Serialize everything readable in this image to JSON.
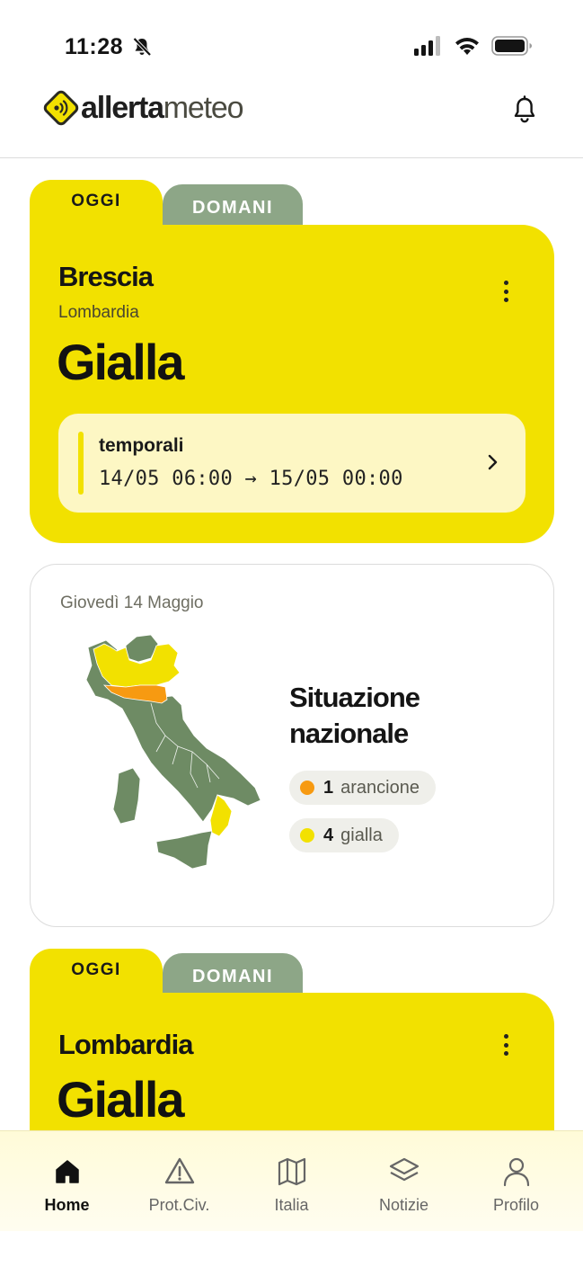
{
  "status": {
    "time": "11:28"
  },
  "header": {
    "logo_bold": "allerta",
    "logo_light": "meteo"
  },
  "tabs": {
    "today": "OGGI",
    "tomorrow": "DOMANI"
  },
  "city_alert": {
    "city": "Brescia",
    "region": "Lombardia",
    "level": "Gialla",
    "event": {
      "title": "temporali",
      "range": "14/05 06:00 → 15/05 00:00"
    }
  },
  "national": {
    "date": "Giovedì 14 Maggio",
    "title": "Situazione nazionale",
    "counts": [
      {
        "count": "1",
        "label": "arancione",
        "color": "#f79a11"
      },
      {
        "count": "4",
        "label": "gialla",
        "color": "#f2e100"
      }
    ]
  },
  "region_alert": {
    "region": "Lombardia",
    "level": "Gialla"
  },
  "colors": {
    "accent_yellow": "#f2e100",
    "tab_green": "#8da687",
    "map_green": "#6e8b64",
    "map_orange": "#f79a11"
  },
  "nav": [
    {
      "label": "Home",
      "icon": "home-icon",
      "active": true
    },
    {
      "label": "Prot.Civ.",
      "icon": "warning-triangle-icon",
      "active": false
    },
    {
      "label": "Italia",
      "icon": "map-icon",
      "active": false
    },
    {
      "label": "Notizie",
      "icon": "layers-icon",
      "active": false
    },
    {
      "label": "Profilo",
      "icon": "user-icon",
      "active": false
    }
  ]
}
